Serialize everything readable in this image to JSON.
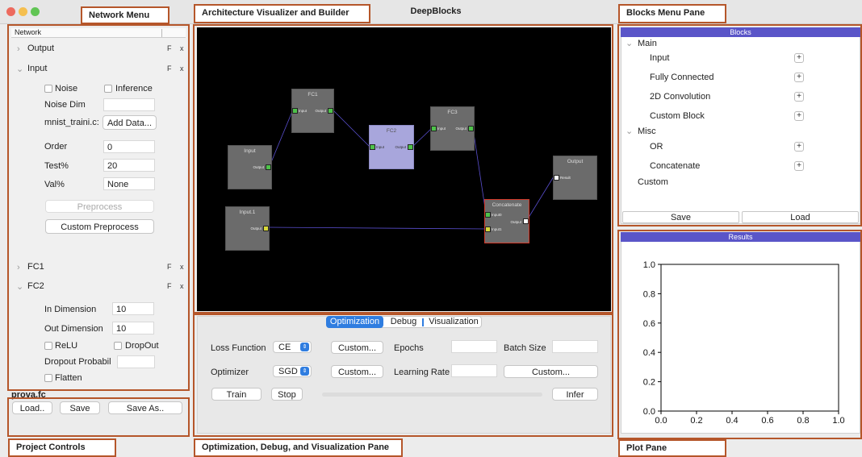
{
  "window": {
    "title": "DeepBlocks"
  },
  "callouts": {
    "network_menu": "Network Menu",
    "architecture": "Architecture Visualizer and Builder",
    "blocks_menu": "Blocks Menu Pane",
    "project_controls": "Project Controls",
    "opt_pane": "Optimization, Debug, and Visualization Pane",
    "plot_pane": "Plot Pane"
  },
  "network": {
    "header": "Network",
    "items": [
      {
        "label": "Output",
        "expanded": false
      },
      {
        "label": "Input",
        "expanded": true
      },
      {
        "label": "FC1",
        "expanded": false
      },
      {
        "label": "FC2",
        "expanded": true
      }
    ],
    "fx_label": "F x",
    "input_panel": {
      "noise_label": "Noise",
      "inference_label": "Inference",
      "noise_dim_label": "Noise Dim",
      "dataset_name": "mnist_traini.c:",
      "add_data_label": "Add Data...",
      "order_label": "Order",
      "order_value": "0",
      "test_label": "Test%",
      "test_value": "20",
      "val_label": "Val%",
      "val_value": "None",
      "preprocess_label": "Preprocess",
      "custom_preprocess_label": "Custom Preprocess"
    },
    "fc2_panel": {
      "in_dim_label": "In Dimension",
      "in_dim_value": "10",
      "out_dim_label": "Out Dimension",
      "out_dim_value": "10",
      "relu_label": "ReLU",
      "dropout_label": "DropOut",
      "dropout_prob_label": "Dropout Probabil",
      "flatten_label": "Flatten"
    }
  },
  "project": {
    "filename": "prova.fc",
    "load_label": "Load..",
    "save_label": "Save",
    "save_as_label": "Save As.."
  },
  "graph": {
    "nodes": {
      "fc1": {
        "title": "FC1",
        "in": "Input",
        "out": "Output"
      },
      "fc2": {
        "title": "FC2",
        "in": "Input",
        "out": "Output"
      },
      "fc3": {
        "title": "FC3",
        "in": "Input",
        "out": "Output"
      },
      "input": {
        "title": "Input",
        "out": "Output"
      },
      "input1": {
        "title": "Input.1",
        "out": "Output"
      },
      "concat": {
        "title": "Concatenate",
        "in0": "Input0",
        "in1": "Input1",
        "out": "Output"
      },
      "output": {
        "title": "Output",
        "in": "Result"
      }
    }
  },
  "blocks": {
    "header": "Blocks",
    "groups": [
      {
        "label": "Main"
      },
      {
        "label": "Misc"
      }
    ],
    "items": {
      "input": "Input",
      "fully_connected": "Fully Connected",
      "conv2d": "2D Convolution",
      "custom_block": "Custom Block",
      "or": "OR",
      "concatenate": "Concatenate",
      "custom": "Custom"
    },
    "plus_glyph": "+",
    "save_label": "Save",
    "load_label": "Load"
  },
  "results": {
    "header": "Results"
  },
  "chart_data": {
    "type": "line",
    "title": "",
    "xlabel": "",
    "ylabel": "",
    "xlim": [
      0.0,
      1.0
    ],
    "ylim": [
      0.0,
      1.0
    ],
    "xticks": [
      "0.0",
      "0.2",
      "0.4",
      "0.6",
      "0.8",
      "1.0"
    ],
    "yticks": [
      "0.0",
      "0.2",
      "0.4",
      "0.6",
      "0.8",
      "1.0"
    ],
    "series": []
  },
  "optimization": {
    "tabs": [
      "Optimization",
      "Debug",
      "Visualization"
    ],
    "active_tab": "Optimization",
    "loss_label": "Loss Function",
    "loss_value": "CE",
    "custom_label": "Custom...",
    "epochs_label": "Epochs",
    "batch_label": "Batch Size",
    "optimizer_label": "Optimizer",
    "optimizer_value": "SGD",
    "lr_label": "Learning Rate",
    "train_label": "Train",
    "stop_label": "Stop",
    "infer_label": "Infer",
    "progress": 0
  }
}
